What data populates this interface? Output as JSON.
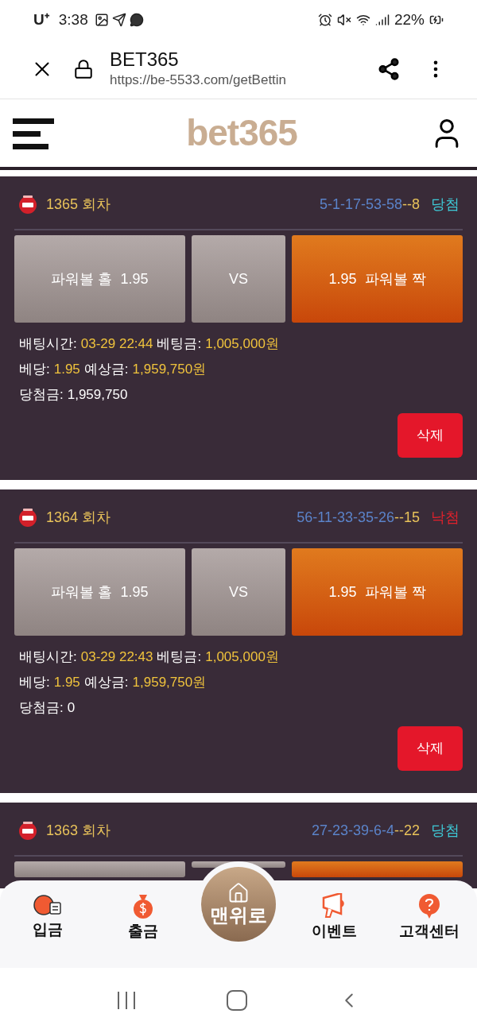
{
  "status_bar": {
    "carrier": "U⁺",
    "time": "3:38",
    "battery": "22%"
  },
  "browser": {
    "title": "BET365",
    "url": "https://be-5533.com/getBettin"
  },
  "header": {
    "logo": "bet365"
  },
  "bets": [
    {
      "round": "1365 회차",
      "numbers": "5-1-17-53-58",
      "power": "--8",
      "result": "당첨",
      "kind": "win",
      "picks": [
        {
          "label": "파워볼 홀  1.95",
          "selected": false
        },
        {
          "label": "VS",
          "selected": false
        },
        {
          "label": "1.95  파워볼 짝",
          "selected": true
        }
      ],
      "lines": [
        [
          {
            "text": "배팅시간:",
            "kind": "label"
          },
          {
            "text": "03-29 22:44",
            "kind": "value"
          },
          {
            "text": "베팅금:",
            "kind": "label"
          },
          {
            "text": "1,005,000원",
            "kind": "value"
          }
        ],
        [
          {
            "text": "베당:",
            "kind": "label"
          },
          {
            "text": "1.95",
            "kind": "value"
          },
          {
            "text": "예상금:",
            "kind": "label"
          },
          {
            "text": "1,959,750원",
            "kind": "value"
          }
        ],
        [
          {
            "text": "당첨금:",
            "kind": "label"
          },
          {
            "text": "1,959,750",
            "kind": "label"
          }
        ]
      ],
      "delete": "삭제"
    },
    {
      "round": "1364 회차",
      "numbers": "56-11-33-35-26",
      "power": "--15",
      "result": "낙첨",
      "kind": "lose",
      "picks": [
        {
          "label": "파워볼 홀  1.95",
          "selected": false
        },
        {
          "label": "VS",
          "selected": false
        },
        {
          "label": "1.95  파워볼 짝",
          "selected": true
        }
      ],
      "lines": [
        [
          {
            "text": "배팅시간:",
            "kind": "label"
          },
          {
            "text": "03-29 22:43",
            "kind": "value"
          },
          {
            "text": "베팅금:",
            "kind": "label"
          },
          {
            "text": "1,005,000원",
            "kind": "value"
          }
        ],
        [
          {
            "text": "베당:",
            "kind": "label"
          },
          {
            "text": "1.95",
            "kind": "value"
          },
          {
            "text": "예상금:",
            "kind": "label"
          },
          {
            "text": "1,959,750원",
            "kind": "value"
          }
        ],
        [
          {
            "text": "당첨금:",
            "kind": "label"
          },
          {
            "text": "0",
            "kind": "label"
          }
        ]
      ],
      "delete": "삭제"
    },
    {
      "round": "1363 회차",
      "numbers": "27-23-39-6-4",
      "power": "--22",
      "result": "당첨",
      "kind": "win",
      "picks": [
        {
          "selected": false
        },
        {
          "selected": false
        },
        {
          "selected": true
        }
      ]
    }
  ],
  "bottom_nav": [
    {
      "label": "입금",
      "kind": "deposit"
    },
    {
      "label": "출금",
      "kind": "withdraw"
    },
    {
      "label": "맨위로",
      "kind": "top"
    },
    {
      "label": "이벤트",
      "kind": "event"
    },
    {
      "label": "고객센터",
      "kind": "help"
    }
  ]
}
